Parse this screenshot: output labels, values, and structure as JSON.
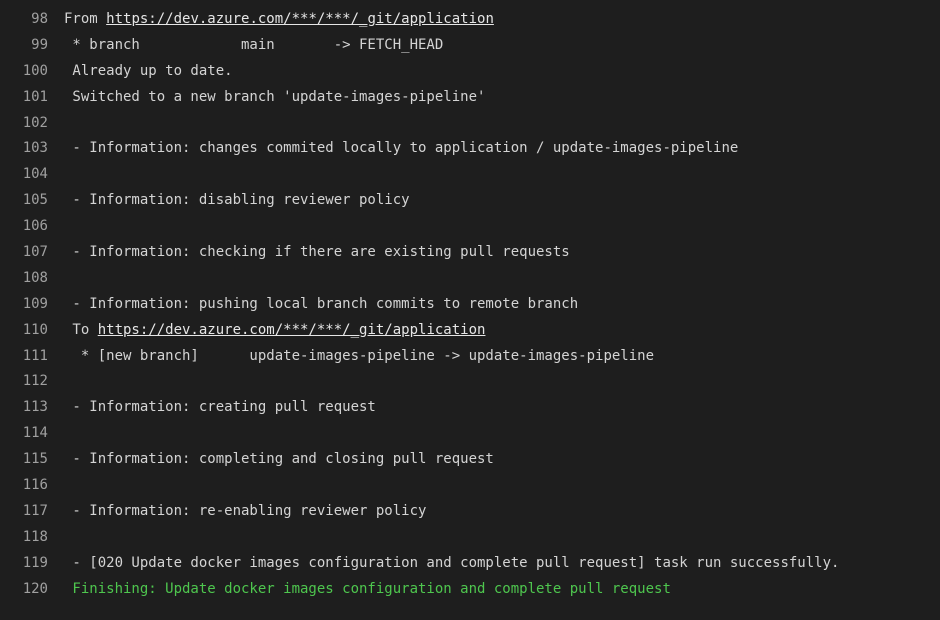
{
  "colors": {
    "background": "#1e1e1e",
    "text": "#d4d4d4",
    "line_number": "#a0a0a0",
    "success": "#4ec64e"
  },
  "lines": [
    {
      "n": "98",
      "pre": "From ",
      "link": "https://dev.azure.com/***/***/_git/application",
      "post": ""
    },
    {
      "n": "99",
      "pre": " * branch            main       -> FETCH_HEAD"
    },
    {
      "n": "100",
      "pre": " Already up to date."
    },
    {
      "n": "101",
      "pre": " Switched to a new branch 'update-images-pipeline'"
    },
    {
      "n": "102",
      "pre": ""
    },
    {
      "n": "103",
      "pre": " - Information: changes commited locally to application / update-images-pipeline"
    },
    {
      "n": "104",
      "pre": ""
    },
    {
      "n": "105",
      "pre": " - Information: disabling reviewer policy"
    },
    {
      "n": "106",
      "pre": ""
    },
    {
      "n": "107",
      "pre": " - Information: checking if there are existing pull requests"
    },
    {
      "n": "108",
      "pre": ""
    },
    {
      "n": "109",
      "pre": " - Information: pushing local branch commits to remote branch"
    },
    {
      "n": "110",
      "pre": " To ",
      "link": "https://dev.azure.com/***/***/_git/application",
      "post": ""
    },
    {
      "n": "111",
      "pre": "  * [new branch]      update-images-pipeline -> update-images-pipeline"
    },
    {
      "n": "112",
      "pre": ""
    },
    {
      "n": "113",
      "pre": " - Information: creating pull request"
    },
    {
      "n": "114",
      "pre": ""
    },
    {
      "n": "115",
      "pre": " - Information: completing and closing pull request"
    },
    {
      "n": "116",
      "pre": ""
    },
    {
      "n": "117",
      "pre": " - Information: re-enabling reviewer policy"
    },
    {
      "n": "118",
      "pre": ""
    },
    {
      "n": "119",
      "pre": " - [020 Update docker images configuration and complete pull request] task run successfully."
    },
    {
      "n": "120",
      "pre": " Finishing: Update docker images configuration and complete pull request",
      "status": "success"
    }
  ]
}
